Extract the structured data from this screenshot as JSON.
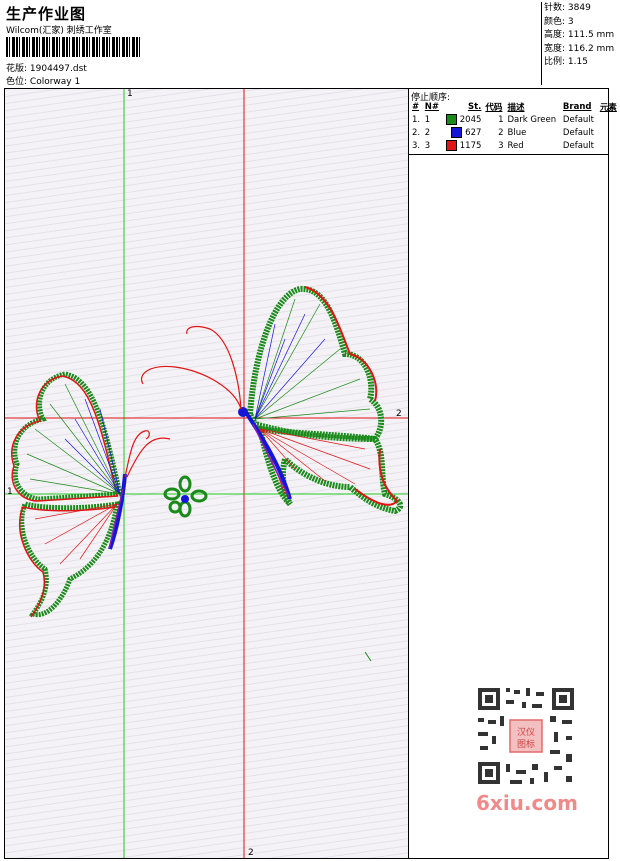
{
  "header": {
    "title": "生产作业图",
    "studio": "Wilcom(汇家) 刺绣工作室",
    "pattern_label": "花版:",
    "pattern_value": "1904497.dst",
    "colorway_label": "色位:",
    "colorway_value": "Colorway 1"
  },
  "stats": {
    "stitches_label": "针数:",
    "stitches": "3849",
    "colors_label": "颜色:",
    "colors": "3",
    "height_label": "高度:",
    "height": "111.5 mm",
    "width_label": "宽度:",
    "width": "116.2 mm",
    "scale_label": "比例:",
    "scale": "1.15"
  },
  "stop_sequence": {
    "title": "停止顺序:",
    "columns": [
      "#",
      "N#",
      "St.",
      "代码",
      "描述",
      "Brand",
      "元素"
    ],
    "rows": [
      {
        "num": "1.",
        "n": "1",
        "color": "#1a8a1a",
        "st": "2045",
        "code": "1",
        "desc": "Dark Green",
        "brand": "Default"
      },
      {
        "num": "2.",
        "n": "2",
        "color": "#1515d8",
        "st": "627",
        "code": "2",
        "desc": "Blue",
        "brand": "Default"
      },
      {
        "num": "3.",
        "n": "3",
        "color": "#e01515",
        "st": "1175",
        "code": "3",
        "desc": "Red",
        "brand": "Default"
      }
    ]
  },
  "guides": {
    "v1": "1",
    "h2": "2",
    "v2": "2",
    "h1": "1"
  },
  "colors": {
    "green": "#1a8a1a",
    "blue": "#1515d8",
    "red": "#e01515",
    "guide_green": "#22cc22",
    "guide_red": "#dd1111"
  },
  "watermark": {
    "text": "6xiu.com",
    "stamp": "汉仪图标"
  }
}
